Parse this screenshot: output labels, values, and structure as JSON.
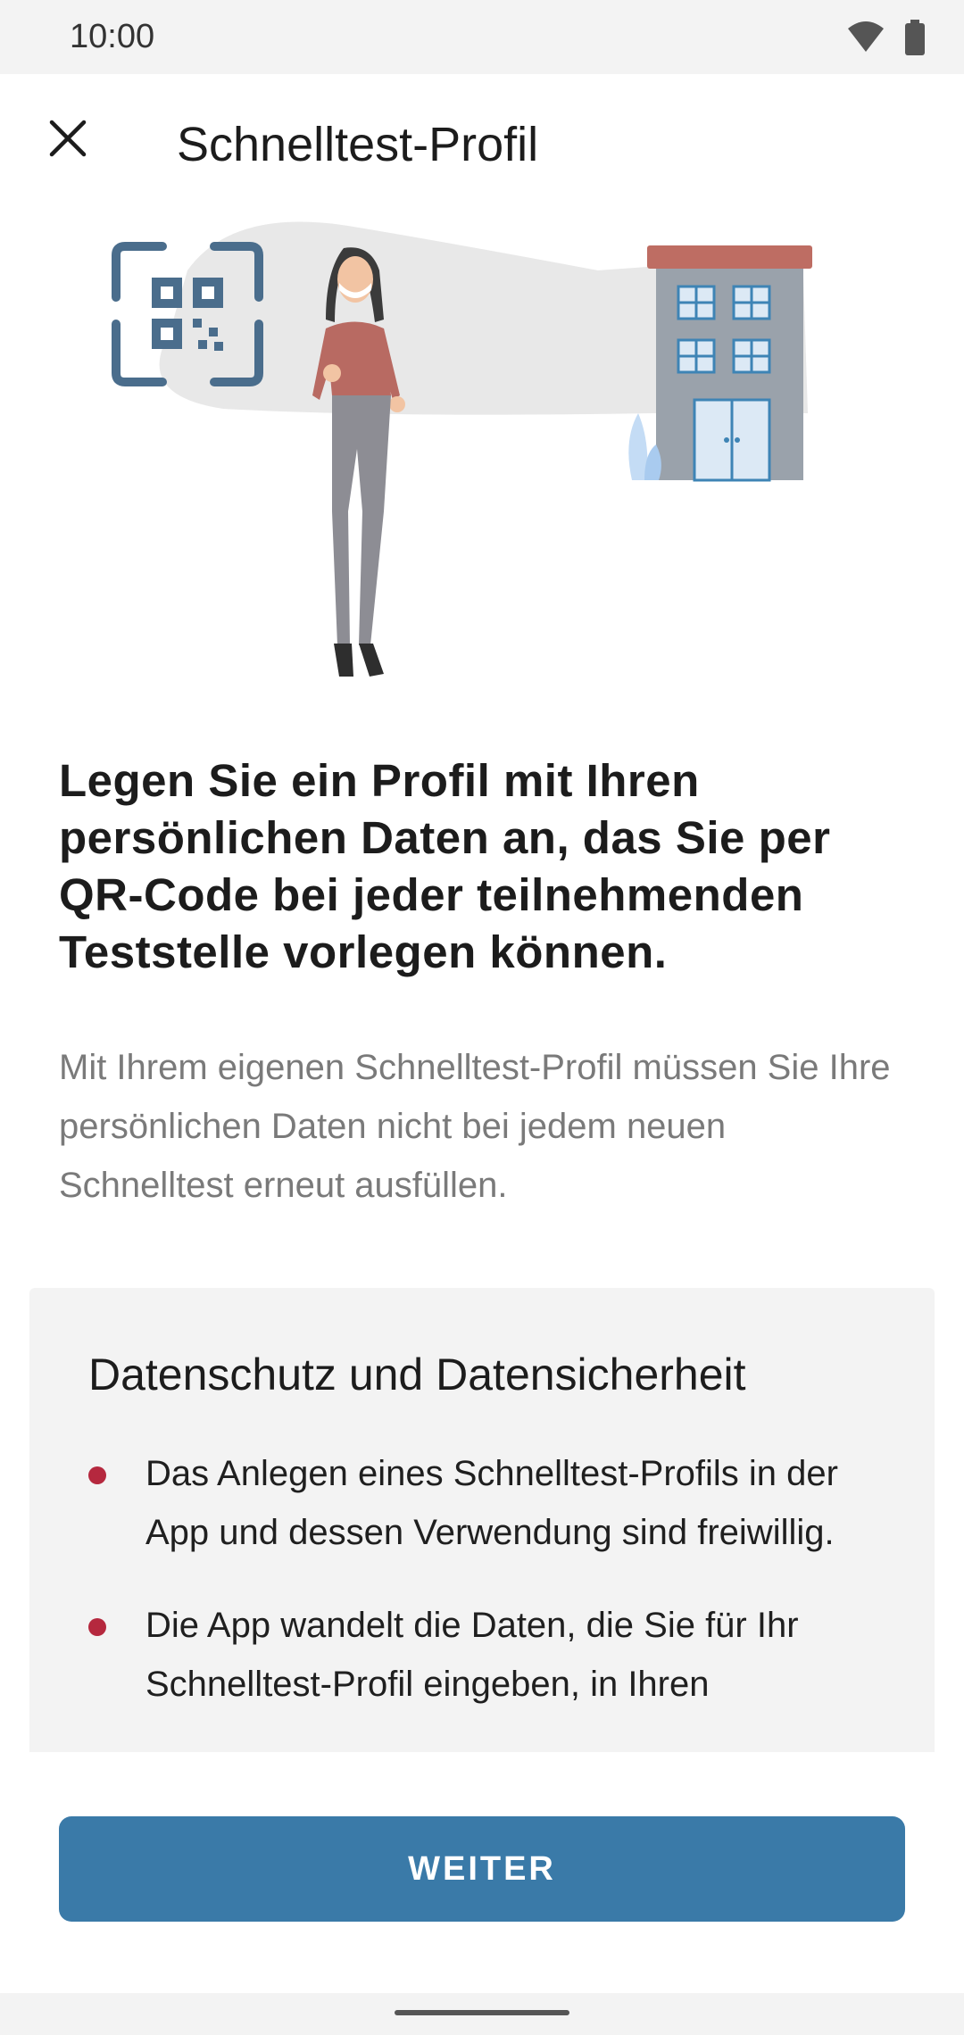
{
  "status_bar": {
    "time": "10:00",
    "icons": [
      "wifi-icon",
      "battery-icon"
    ]
  },
  "app_bar": {
    "title": "Schnelltest-Profil",
    "close_icon": "close-icon"
  },
  "content": {
    "headline": "Legen Sie ein Profil mit Ihren persönlichen Daten an, das Sie per QR-Code bei jeder teilnehmenden Teststelle vorlegen können.",
    "description": "Mit Ihrem eigenen Schnelltest-Profil müssen Sie Ihre persönlichen Daten nicht bei jedem neuen Schnelltest erneut ausfüllen.",
    "privacy_card": {
      "title": "Datenschutz und Datensicherheit",
      "bullets": [
        "Das Anlegen eines Schnelltest-Profils in der App und dessen Verwendung sind freiwillig.",
        "Die App wandelt die Daten, die Sie für Ihr Schnelltest-Profil eingeben, in Ihren"
      ]
    }
  },
  "footer": {
    "button_label": "WEITER"
  },
  "colors": {
    "primary": "#3a7aa8",
    "bullet": "#b5283e",
    "card_background": "#f3f3f3",
    "secondary_text": "#7a7a7a"
  }
}
